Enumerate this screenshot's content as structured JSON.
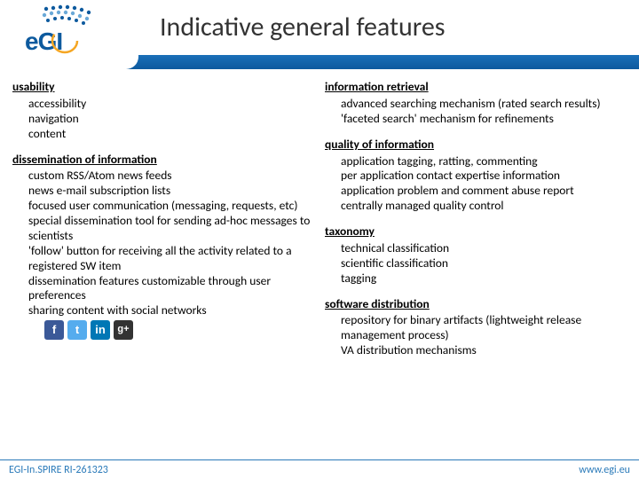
{
  "header": {
    "title": "Indicative general features",
    "logo_text": "eGI"
  },
  "left": {
    "sec1": {
      "title": "usability",
      "items": [
        "accessibility",
        "navigation",
        "content"
      ]
    },
    "sec2": {
      "title": "dissemination of information",
      "items": [
        "custom RSS/Atom news feeds",
        "news e-mail subscription lists",
        "focused user communication (messaging, requests, etc)",
        "special dissemination tool for sending ad-hoc messages to scientists",
        "'follow' button for receiving all the activity related to a registered SW item",
        "dissemination features customizable through user preferences",
        "sharing content with social networks"
      ]
    }
  },
  "right": {
    "sec1": {
      "title": "information retrieval",
      "items": [
        "advanced searching mechanism (rated search results)",
        "'faceted search' mechanism for refinements"
      ]
    },
    "sec2": {
      "title": "quality of information",
      "items": [
        "application tagging, ratting, commenting",
        "per application contact expertise information",
        "application problem and comment abuse report",
        "centrally managed quality control"
      ]
    },
    "sec3": {
      "title": "taxonomy",
      "items": [
        "technical classification",
        "scientific classification",
        "tagging"
      ]
    },
    "sec4": {
      "title": "software distribution",
      "items": [
        "repository for binary artifacts (lightweight release management process)",
        "VA distribution mechanisms"
      ]
    }
  },
  "footer": {
    "left": "EGI-In.SPIRE RI-261323",
    "right": "www.egi.eu"
  },
  "social": {
    "fb": "f",
    "tw": "t",
    "li": "in",
    "gp": "g+"
  }
}
